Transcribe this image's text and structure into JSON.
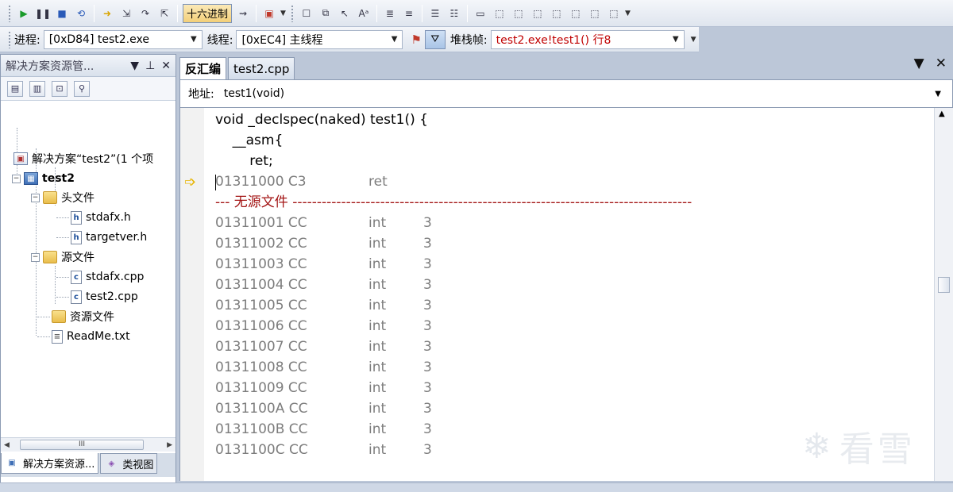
{
  "toolbar1": {
    "hex_button_label": "十六进制",
    "icons": [
      "continue-icon",
      "break-all-icon",
      "stop-icon",
      "restart-icon",
      "show-next-statement-icon",
      "step-into-icon",
      "step-over-icon",
      "step-out-icon",
      "hex-toggle",
      "breakpoint-icon",
      "watch-icon"
    ]
  },
  "toolbar2": {
    "process_label": "进程:",
    "process_value": "[0xD84] test2.exe",
    "thread_label": "线程:",
    "thread_value": "[0xEC4] 主线程",
    "stack_label": "堆栈帧:",
    "stack_value": "test2.exe!test1()  行8"
  },
  "solution_explorer": {
    "title": "解决方案资源管...",
    "pin_glyph": "▼",
    "close_glyph": "✕",
    "tree": {
      "solution": "解决方案“test2”(1 个项",
      "project": "test2",
      "header_folder": "头文件",
      "header_files": [
        "stdafx.h",
        "targetver.h"
      ],
      "source_folder": "源文件",
      "source_files": [
        "stdafx.cpp",
        "test2.cpp"
      ],
      "resource_folder": "资源文件",
      "readme": "ReadMe.txt"
    },
    "tabs": [
      "解决方案资源...",
      "类视图"
    ],
    "scroll_thumb_text": "III"
  },
  "document": {
    "tabs": [
      "反汇编",
      "test2.cpp"
    ],
    "address_label": "地址:",
    "address_value": "test1(void)",
    "source_lines": [
      "void _declspec(naked) test1() {",
      "    __asm{",
      "        ret;"
    ],
    "current_instruction": {
      "addr": "01311000 C3",
      "op": "ret",
      "arg": ""
    },
    "no_source_marker": "--- 无源文件 ----------------------------------------------------------------------------------",
    "instructions": [
      {
        "addr": "01311001 CC",
        "op": "int",
        "arg": "3"
      },
      {
        "addr": "01311002 CC",
        "op": "int",
        "arg": "3"
      },
      {
        "addr": "01311003 CC",
        "op": "int",
        "arg": "3"
      },
      {
        "addr": "01311004 CC",
        "op": "int",
        "arg": "3"
      },
      {
        "addr": "01311005 CC",
        "op": "int",
        "arg": "3"
      },
      {
        "addr": "01311006 CC",
        "op": "int",
        "arg": "3"
      },
      {
        "addr": "01311007 CC",
        "op": "int",
        "arg": "3"
      },
      {
        "addr": "01311008 CC",
        "op": "int",
        "arg": "3"
      },
      {
        "addr": "01311009 CC",
        "op": "int",
        "arg": "3"
      },
      {
        "addr": "0131100A CC",
        "op": "int",
        "arg": "3"
      },
      {
        "addr": "0131100B CC",
        "op": "int",
        "arg": "3"
      },
      {
        "addr": "0131100C CC",
        "op": "int",
        "arg": "3"
      }
    ]
  },
  "watermark": {
    "text": "看雪"
  },
  "colors": {
    "accent": "#f3cf79",
    "no_source": "#a31515",
    "asm_text": "#7d7d7d",
    "pointer": "#e7b400"
  }
}
